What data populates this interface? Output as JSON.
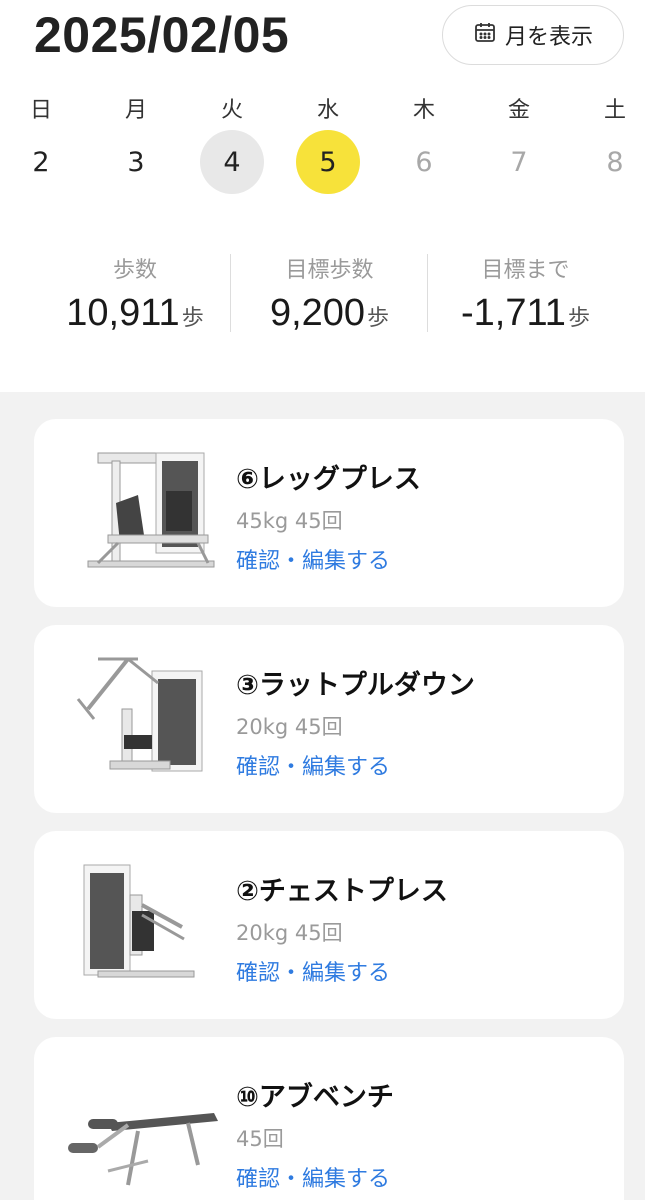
{
  "header": {
    "date": "2025/02/05",
    "month_button_label": "月を表示"
  },
  "week": [
    {
      "dow": "日",
      "num": "2",
      "state": "past"
    },
    {
      "dow": "月",
      "num": "3",
      "state": "past"
    },
    {
      "dow": "火",
      "num": "4",
      "state": "prev"
    },
    {
      "dow": "水",
      "num": "5",
      "state": "today"
    },
    {
      "dow": "木",
      "num": "6",
      "state": "future"
    },
    {
      "dow": "金",
      "num": "7",
      "state": "future"
    },
    {
      "dow": "土",
      "num": "8",
      "state": "future"
    }
  ],
  "stats": [
    {
      "label": "歩数",
      "value": "10,911",
      "unit": "歩"
    },
    {
      "label": "目標歩数",
      "value": "9,200",
      "unit": "歩"
    },
    {
      "label": "目標まで",
      "value": "-1,711",
      "unit": "歩"
    }
  ],
  "workouts": [
    {
      "title": "⑥レッグプレス",
      "detail": "45kg 45回",
      "link": "確認・編集する",
      "machine": "leg-press"
    },
    {
      "title": "③ラットプルダウン",
      "detail": "20kg 45回",
      "link": "確認・編集する",
      "machine": "lat-pulldown"
    },
    {
      "title": "②チェストプレス",
      "detail": "20kg 45回",
      "link": "確認・編集する",
      "machine": "chest-press"
    },
    {
      "title": "⑩アブベンチ",
      "detail": "45回",
      "link": "確認・編集する",
      "machine": "ab-bench"
    }
  ],
  "colors": {
    "today": "#f7e23a",
    "prev": "#e8e8e8",
    "link": "#2f7be0",
    "background": "#f2f2f2"
  }
}
